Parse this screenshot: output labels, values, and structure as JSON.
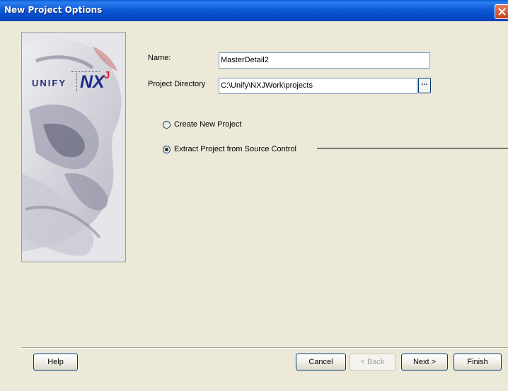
{
  "window": {
    "title": "New Project Options"
  },
  "logo": {
    "brand": "UNIFY",
    "product": "NX",
    "superscript": "J"
  },
  "form": {
    "name_label": "Name:",
    "name_value": "MasterDetail2",
    "directory_label": "Project Directory",
    "directory_value": "C:\\Unify\\NXJWork\\projects",
    "browse_label": "..."
  },
  "options": {
    "create_new": {
      "label": "Create New Project",
      "selected": false
    },
    "extract": {
      "label": "Extract Project from Source Control",
      "selected": true
    }
  },
  "buttons": {
    "help": "Help",
    "cancel": "Cancel",
    "back": "< Back",
    "next": "Next >",
    "finish": "Finish"
  },
  "colors": {
    "titlebar": "#0a5fd8",
    "dialog_bg": "#ece9d8",
    "button_border": "#003c74"
  }
}
